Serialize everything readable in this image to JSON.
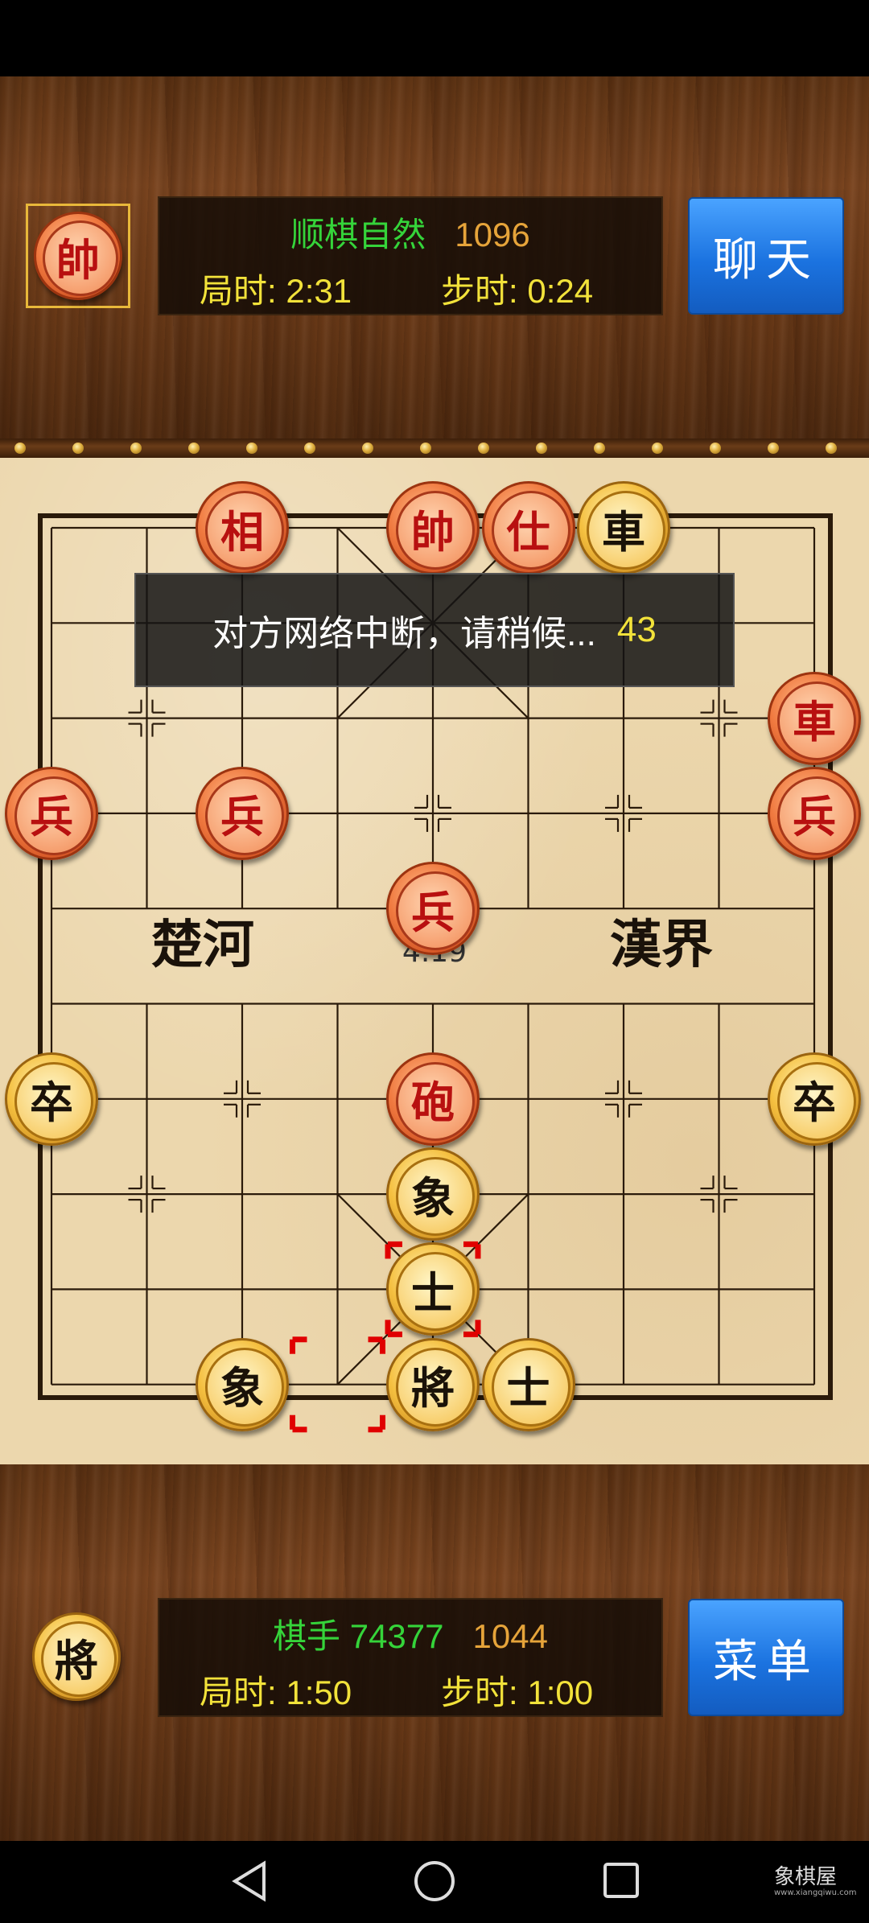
{
  "opponent": {
    "avatar_piece": "帥",
    "name": "顺棋自然",
    "rating": "1096",
    "game_time_label": "局时: 2:31",
    "move_time_label": "步时: 0:24",
    "chat_button": "聊天"
  },
  "player": {
    "avatar_piece": "將",
    "name": "棋手 74377",
    "rating": "1044",
    "game_time_label": "局时: 1:50",
    "move_time_label": "步时: 1:00",
    "menu_button": "菜单"
  },
  "notification": {
    "message": "对方网络中断，请稍候...",
    "countdown": "43"
  },
  "board": {
    "river_left": "楚河",
    "river_right": "漢界",
    "center_text": "4.19",
    "pieces": [
      {
        "char": "相",
        "side": "red",
        "col": 2,
        "row": 0
      },
      {
        "char": "帥",
        "side": "red",
        "col": 4,
        "row": 0
      },
      {
        "char": "仕",
        "side": "red",
        "col": 5,
        "row": 0
      },
      {
        "char": "車",
        "side": "black",
        "col": 6,
        "row": 0
      },
      {
        "char": "車",
        "side": "red",
        "col": 8,
        "row": 2
      },
      {
        "char": "兵",
        "side": "red",
        "col": 0,
        "row": 3
      },
      {
        "char": "兵",
        "side": "red",
        "col": 2,
        "row": 3
      },
      {
        "char": "兵",
        "side": "red",
        "col": 8,
        "row": 3
      },
      {
        "char": "兵",
        "side": "red",
        "col": 4,
        "row": 4
      },
      {
        "char": "卒",
        "side": "black",
        "col": 0,
        "row": 6
      },
      {
        "char": "砲",
        "side": "red",
        "col": 4,
        "row": 6
      },
      {
        "char": "卒",
        "side": "black",
        "col": 8,
        "row": 6
      },
      {
        "char": "象",
        "side": "black",
        "col": 4,
        "row": 7
      },
      {
        "char": "士",
        "side": "black",
        "col": 4,
        "row": 8
      },
      {
        "char": "象",
        "side": "black",
        "col": 2,
        "row": 9
      },
      {
        "char": "將",
        "side": "black",
        "col": 4,
        "row": 9
      },
      {
        "char": "士",
        "side": "black",
        "col": 5,
        "row": 9
      }
    ],
    "last_move_from": {
      "col": 3,
      "row": 9
    },
    "last_move_to": {
      "col": 4,
      "row": 8
    }
  },
  "watermark": {
    "text": "象棋屋",
    "url": "www.xiangqiwu.com"
  },
  "nav": {
    "back_icon": "triangle-back-icon",
    "home_icon": "circle-home-icon",
    "recents_icon": "square-recents-icon"
  }
}
